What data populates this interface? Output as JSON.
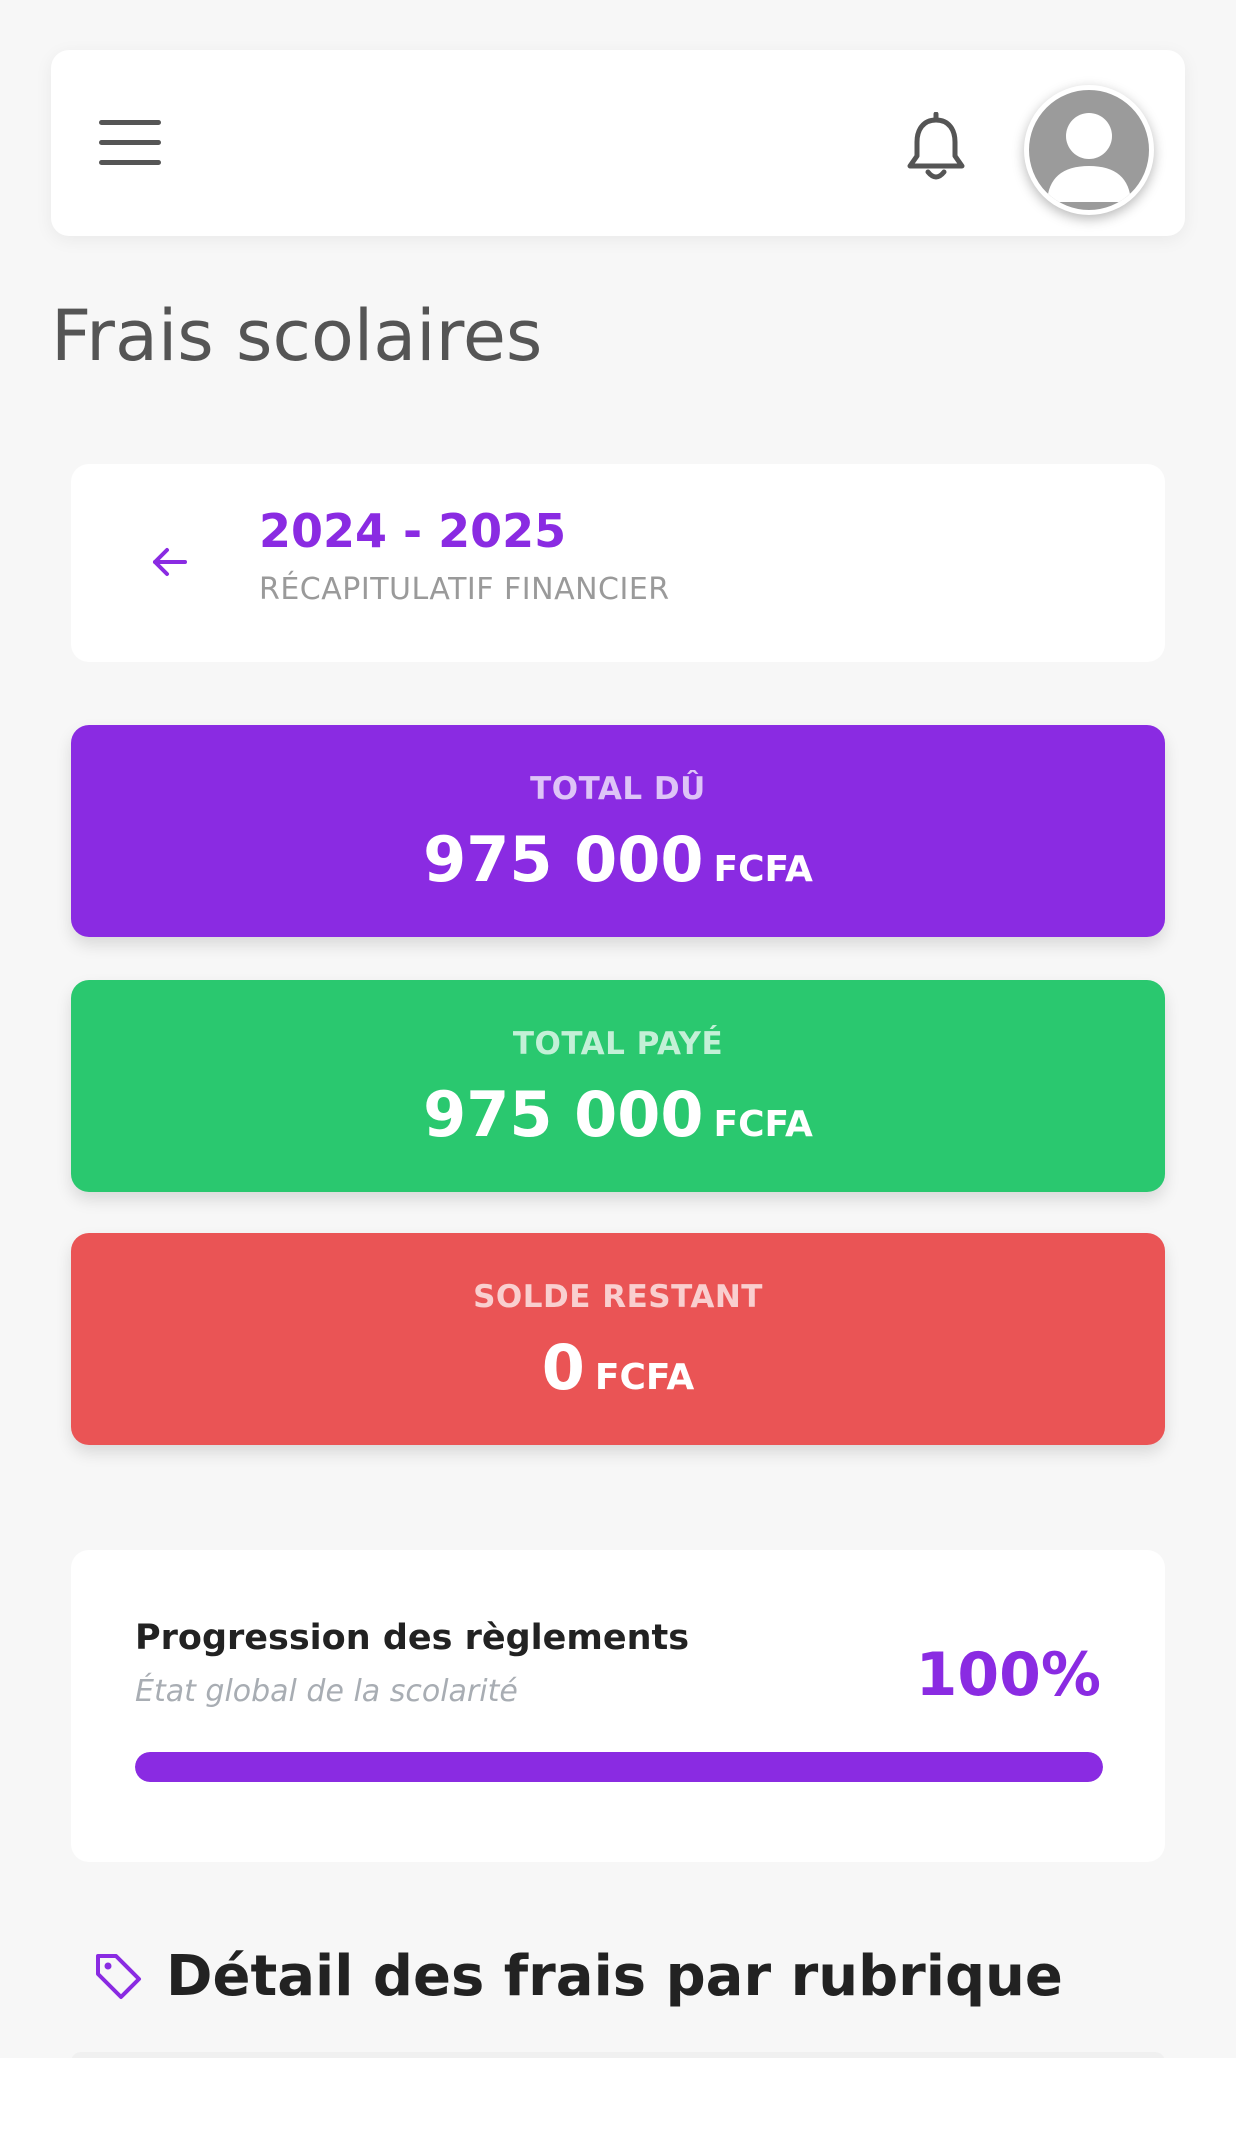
{
  "header": {
    "menu_icon": "hamburger-menu-icon",
    "notification_icon": "bell-icon",
    "avatar_icon": "user-avatar-icon"
  },
  "page": {
    "title": "Frais scolaires"
  },
  "year_selector": {
    "back_icon": "arrow-left-icon",
    "year": "2024 - 2025",
    "subtitle": "RÉCAPITULATIF FINANCIER"
  },
  "summary": {
    "total_du": {
      "label": "TOTAL DÛ",
      "amount": "975 000",
      "currency": "FCFA",
      "color": "#8a2be2"
    },
    "total_paye": {
      "label": "TOTAL PAYÉ",
      "amount": "975 000",
      "currency": "FCFA",
      "color": "#2ac86f"
    },
    "solde_restant": {
      "label": "SOLDE RESTANT",
      "amount": "0",
      "currency": "FCFA",
      "color": "#ea5455"
    }
  },
  "progress": {
    "title": "Progression des règlements",
    "subtitle": "État global de la scolarité",
    "percent_label": "100%",
    "value": 1.0
  },
  "section": {
    "icon": "tag-icon",
    "title": "Détail des frais par rubrique"
  },
  "colors": {
    "accent": "#8a2be2",
    "success": "#2ac86f",
    "danger": "#ea5455",
    "background": "#f7f7f7"
  }
}
